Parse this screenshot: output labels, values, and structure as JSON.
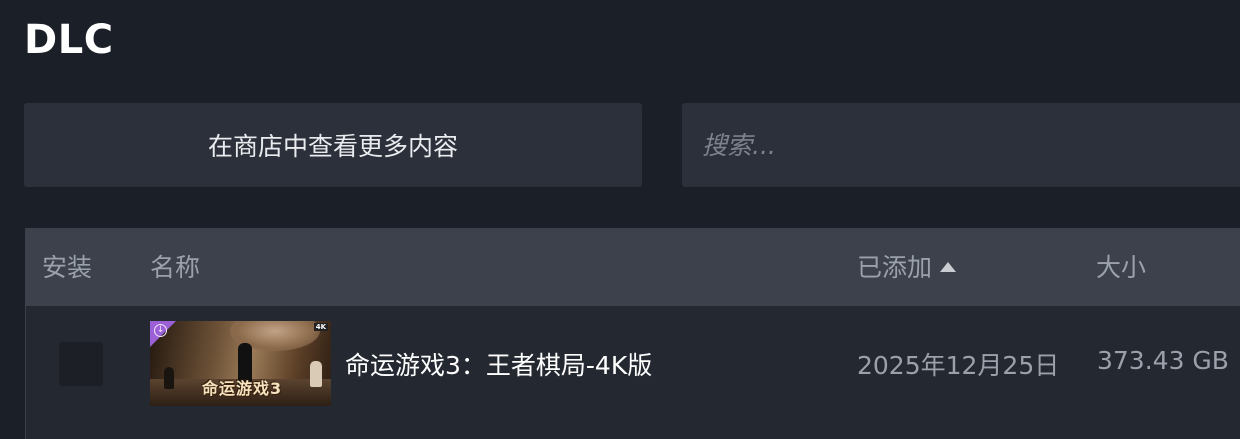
{
  "page": {
    "title": "DLC"
  },
  "toolbar": {
    "store_button_label": "在商店中查看更多内容",
    "search_placeholder": "搜索..."
  },
  "table": {
    "columns": {
      "install": "安装",
      "name": "名称",
      "added": "已添加",
      "size": "大小"
    },
    "sort": {
      "column": "added",
      "direction": "ascending",
      "icon": "sort-ascending-icon"
    },
    "rows": [
      {
        "installed": false,
        "thumbnail": {
          "overlay_text": "命运游戏3",
          "badge": "4K",
          "corner_icon": "download-icon",
          "corner_color": "#9b5fd6"
        },
        "name": "命运游戏3：王者棋局-4K版",
        "added": "2025年12月25日",
        "size": "373.43 GB"
      }
    ]
  },
  "colors": {
    "background": "#1b1f27",
    "panel": "#2c303a",
    "table_header": "#3c414c",
    "row": "#242831",
    "muted_text": "#9ba1ab",
    "primary_text": "#ffffff"
  }
}
